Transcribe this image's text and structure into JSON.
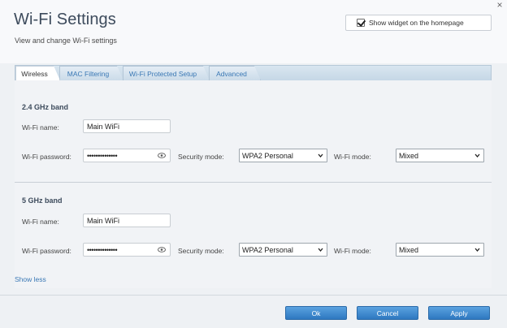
{
  "header": {
    "title": "Wi-Fi Settings",
    "subtitle": "View and change Wi-Fi settings",
    "close_icon": "×",
    "widget_checkbox_checked": true,
    "widget_label": "Show widget on the homepage"
  },
  "tabs": [
    {
      "label": "Wireless",
      "active": true
    },
    {
      "label": "MAC Filtering",
      "active": false
    },
    {
      "label": "Wi-Fi Protected Setup",
      "active": false
    },
    {
      "label": "Advanced",
      "active": false
    }
  ],
  "band24": {
    "title": "2.4 GHz band",
    "name_label": "Wi-Fi name:",
    "name_value": "Main WiFi",
    "password_label": "Wi-Fi password:",
    "password_value": "••••••••••••••",
    "security_label": "Security mode:",
    "security_value": "WPA2 Personal",
    "mode_label": "Wi-Fi mode:",
    "mode_value": "Mixed"
  },
  "band5": {
    "title": "5 GHz band",
    "name_label": "Wi-Fi name:",
    "name_value": "Main WiFi",
    "password_label": "Wi-Fi password:",
    "password_value": "••••••••••••••",
    "security_label": "Security mode:",
    "security_value": "WPA2 Personal",
    "mode_label": "Wi-Fi mode:",
    "mode_value": "Mixed"
  },
  "show_less": "Show less",
  "buttons": {
    "ok": "Ok",
    "cancel": "Cancel",
    "apply": "Apply"
  },
  "colors": {
    "accent": "#3a78b5",
    "button": "#2e78c0"
  }
}
